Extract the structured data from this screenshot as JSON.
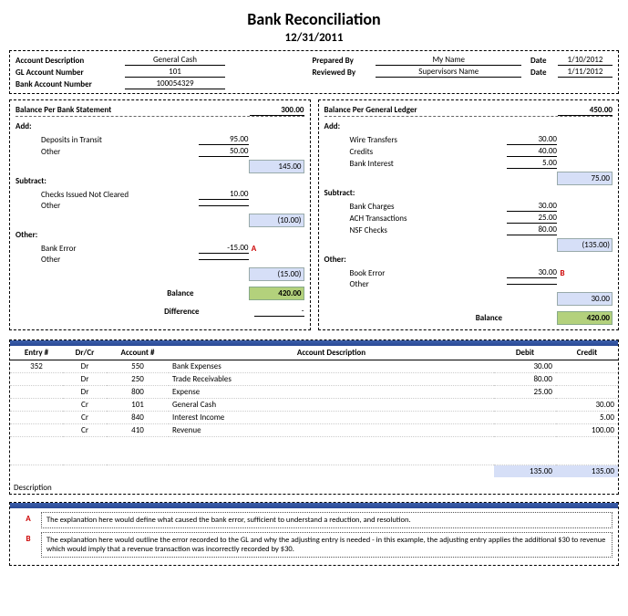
{
  "title": "Bank Reconciliation",
  "date": "12/31/2011",
  "header": {
    "acctDesc": {
      "label": "Account Description",
      "value": "General Cash"
    },
    "glNum": {
      "label": "GL Account Number",
      "value": "101"
    },
    "bankNum": {
      "label": "Bank Account Number",
      "value": "100054329"
    },
    "prepBy": {
      "label": "Prepared By",
      "value": "My Name"
    },
    "revBy": {
      "label": "Reviewed By",
      "value": "Supervisors Name"
    },
    "date1": {
      "label": "Date",
      "value": "1/10/2012"
    },
    "date2": {
      "label": "Date",
      "value": "1/11/2012"
    }
  },
  "bank": {
    "title": "Balance Per Bank Statement",
    "start": "300.00",
    "addLabel": "Add:",
    "addLines": [
      {
        "desc": "Deposits in Transit",
        "amt": "95.00"
      },
      {
        "desc": "Other",
        "amt": "50.00"
      }
    ],
    "addTotal": "145.00",
    "subLabel": "Subtract:",
    "subLines": [
      {
        "desc": "Checks Issued Not Cleared",
        "amt": "10.00"
      },
      {
        "desc": "Other",
        "amt": ""
      }
    ],
    "subTotal": "(10.00)",
    "otherLabel": "Other:",
    "otherLines": [
      {
        "desc": "Bank Error",
        "amt": "-15.00",
        "note": "A"
      },
      {
        "desc": "Other",
        "amt": ""
      }
    ],
    "otherTotal": "(15.00)",
    "balLabel": "Balance",
    "balance": "420.00",
    "diffLabel": "Difference",
    "diff": "-"
  },
  "ledger": {
    "title": "Balance Per General Ledger",
    "start": "450.00",
    "addLabel": "Add:",
    "addLines": [
      {
        "desc": "Wire Transfers",
        "amt": "30.00"
      },
      {
        "desc": "Credits",
        "amt": "40.00"
      },
      {
        "desc": "Bank Interest",
        "amt": "5.00"
      }
    ],
    "addTotal": "75.00",
    "subLabel": "Subtract:",
    "subLines": [
      {
        "desc": "Bank Charges",
        "amt": "30.00"
      },
      {
        "desc": "ACH Transactions",
        "amt": "25.00"
      },
      {
        "desc": "NSF Checks",
        "amt": "80.00"
      }
    ],
    "subTotal": "(135.00)",
    "otherLabel": "Other:",
    "otherLines": [
      {
        "desc": "Book Error",
        "amt": "30.00",
        "note": "B"
      },
      {
        "desc": "Other",
        "amt": ""
      }
    ],
    "otherTotal": "30.00",
    "balLabel": "Balance",
    "balance": "420.00"
  },
  "journal": {
    "headers": {
      "entry": "Entry #",
      "drcr": "Dr/Cr",
      "acct": "Account #",
      "desc": "Account Description",
      "debit": "Debit",
      "credit": "Credit"
    },
    "rows": [
      {
        "entry": "352",
        "drcr": "Dr",
        "acct": "550",
        "desc": "Bank Expenses",
        "debit": "30.00",
        "credit": ""
      },
      {
        "entry": "",
        "drcr": "Dr",
        "acct": "250",
        "desc": "Trade Receivables",
        "debit": "80.00",
        "credit": ""
      },
      {
        "entry": "",
        "drcr": "Dr",
        "acct": "800",
        "desc": "Expense",
        "debit": "25.00",
        "credit": ""
      },
      {
        "entry": "",
        "drcr": "Cr",
        "acct": "101",
        "desc": "General Cash",
        "debit": "",
        "credit": "30.00"
      },
      {
        "entry": "",
        "drcr": "Cr",
        "acct": "840",
        "desc": "Interest Income",
        "debit": "",
        "credit": "5.00"
      },
      {
        "entry": "",
        "drcr": "Cr",
        "acct": "410",
        "desc": "Revenue",
        "debit": "",
        "credit": "100.00"
      }
    ],
    "totalDebit": "135.00",
    "totalCredit": "135.00",
    "descLabel": "Description"
  },
  "notes": [
    {
      "key": "A",
      "text": "The explanation here would define what caused the bank error, sufficient to understand a reduction, and resolution."
    },
    {
      "key": "B",
      "text": "The explanation here would outline the error recorded to the GL and why the adjusting entry is needed - in this example, the adjusting entry applies the additional $30 to revenue which would imply that a revenue transaction was incorrectly recorded by $30."
    }
  ]
}
